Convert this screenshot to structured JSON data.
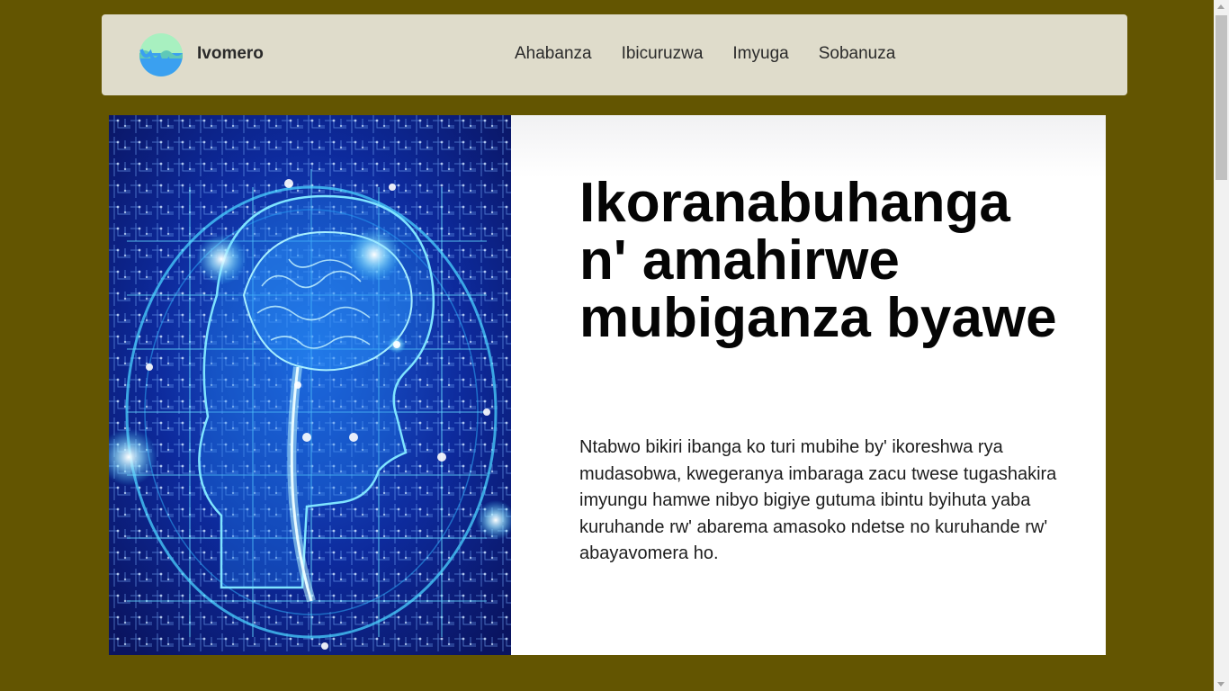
{
  "header": {
    "brand_name": "Ivomero",
    "logo_icon": "water-waves-logo-icon",
    "nav": [
      {
        "label": "Ahabanza"
      },
      {
        "label": "Ibicuruzwa"
      },
      {
        "label": "Imyuga"
      },
      {
        "label": "Sobanuza"
      }
    ]
  },
  "hero": {
    "image_icon": "digital-brain-circuit-image",
    "headline": "Ikoranabuhanga n' amahirwe mubiganza byawe",
    "body": "Ntabwo bikiri ibanga ko turi mubihe by' ikoreshwa rya mudasobwa, kwegeranya imbaraga zacu twese tugashakira imyungu hamwe nibyo bigiye gutuma ibintu byihuta yaba kuruhande rw' abarema amasoko ndetse no kuruhande rw' abayavomera ho."
  },
  "colors": {
    "page_background": "#635501",
    "navbar_background": "#dfdccb",
    "hero_background": "#ffffff",
    "logo_top": "#a8f0c0",
    "logo_bottom": "#3aa0f0",
    "image_primary": "#0a1a8c",
    "image_glow": "#3cc8ff"
  }
}
